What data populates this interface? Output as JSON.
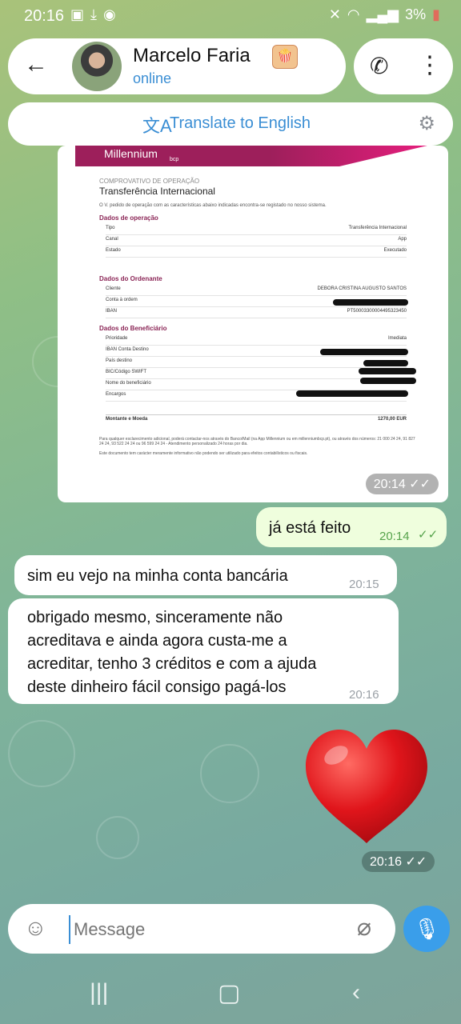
{
  "status_bar": {
    "time": "20:16",
    "battery": "3%",
    "left_icons": [
      "gallery-icon",
      "download-icon",
      "circle-icon"
    ],
    "right_icons": [
      "mute-icon",
      "wifi-icon",
      "signal-icon",
      "battery-icon"
    ]
  },
  "header": {
    "contact_name": "Marcelo Faria",
    "status": "online"
  },
  "translate_bar": {
    "label": "Translate to English"
  },
  "document": {
    "logo": "Millennium",
    "logo_sub": "bcp",
    "subtitle": "COMPROVATIVO DE OPERAÇÃO",
    "title": "Transferência Internacional",
    "intro": "O V. pedido de operação com as características abaixo indicadas encontra-se registado no nosso sistema.",
    "sections": [
      {
        "heading": "Dados de operação",
        "rows": [
          {
            "label": "Tipo",
            "value": "Transferência Internacional"
          },
          {
            "label": "Canal",
            "value": "App"
          },
          {
            "label": "Estado",
            "value": "Executado"
          }
        ]
      },
      {
        "heading": "Dados do Ordenante",
        "rows": [
          {
            "label": "Cliente",
            "value": "DEBORA CRISTINA AUGUSTO SANTOS"
          },
          {
            "label": "Conta à ordem",
            "value": ""
          },
          {
            "label": "IBAN",
            "value": "PT50003300004495323450"
          }
        ]
      },
      {
        "heading": "Dados do Beneficiário",
        "rows": [
          {
            "label": "Prioridade",
            "value": "Imediata"
          },
          {
            "label": "IBAN Conta Destino",
            "value": ""
          },
          {
            "label": "País destino",
            "value": ""
          },
          {
            "label": "BIC/Código SWIFT",
            "value": ""
          },
          {
            "label": "Nome do beneficiário",
            "value": ""
          },
          {
            "label": "Encargos",
            "value": ""
          }
        ]
      }
    ],
    "amount_label": "Montante e Moeda",
    "amount_value": "1270,00 EUR",
    "footer1": "Para qualquer esclarecimento adicional, poderá contactar-nos através do Banco/Mail (na App Millennium ou em millenniumbcp.pt), ou através dos números: 21 000 24 24, 91 827 24 24, 93 522 24 24 ou 96 599 24 24 - Atendimento personalizado 24 horas por dia.",
    "footer2": "Este documento tem carácter meramente informativo não podendo ser utilizado para efeitos contabilísticos ou fiscais."
  },
  "messages": [
    {
      "type": "image",
      "direction": "incoming",
      "time": "20:14"
    },
    {
      "type": "text",
      "direction": "outgoing",
      "text": "já está feito",
      "time": "20:14"
    },
    {
      "type": "text",
      "direction": "incoming",
      "text": "sim eu vejo na minha conta bancária",
      "time": "20:15"
    },
    {
      "type": "text",
      "direction": "incoming",
      "text_lines": [
        "obrigado mesmo, sinceramente não",
        "acreditava e ainda agora custa-me a",
        "acreditar, tenho 3 créditos e com a ajuda",
        "deste dinheiro fácil consigo pagá-los"
      ],
      "time": "20:16"
    },
    {
      "type": "sticker",
      "direction": "outgoing",
      "icon": "heart-emoji",
      "time": "20:16"
    }
  ],
  "composer": {
    "placeholder": "Message"
  },
  "colors": {
    "accent": "#3a8ed4",
    "outgoing_bubble": "#effedd",
    "read_check": "#56a34b",
    "heart": "#e0151b"
  }
}
